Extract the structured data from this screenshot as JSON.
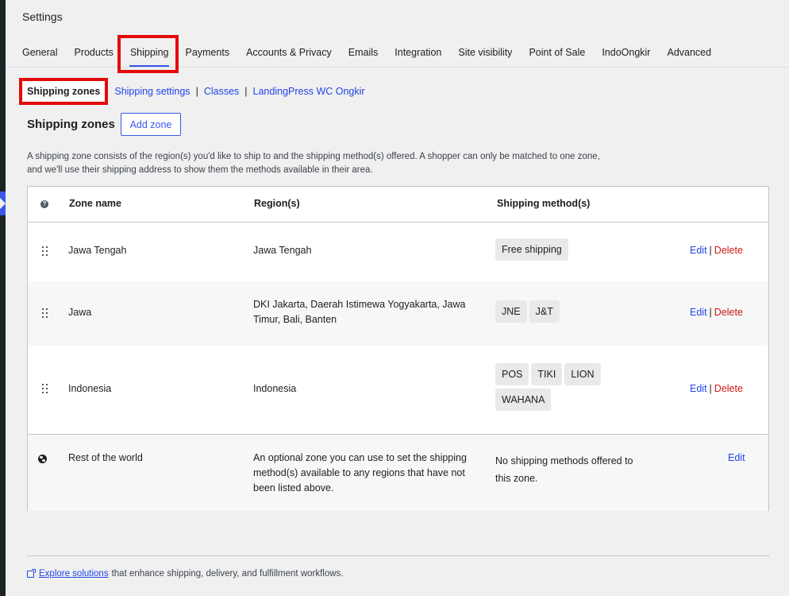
{
  "page": {
    "title": "Settings"
  },
  "tabs": [
    {
      "label": "General"
    },
    {
      "label": "Products"
    },
    {
      "label": "Shipping"
    },
    {
      "label": "Payments"
    },
    {
      "label": "Accounts & Privacy"
    },
    {
      "label": "Emails"
    },
    {
      "label": "Integration"
    },
    {
      "label": "Site visibility"
    },
    {
      "label": "Point of Sale"
    },
    {
      "label": "IndoOngkir"
    },
    {
      "label": "Advanced"
    }
  ],
  "active_tab": "Shipping",
  "subnav": {
    "current": "Shipping zones",
    "links": [
      "Shipping settings",
      "Classes",
      "LandingPress WC Ongkir"
    ],
    "separator": "|"
  },
  "zones": {
    "heading": "Shipping zones",
    "add_button": "Add zone",
    "description": "A shipping zone consists of the region(s) you'd like to ship to and the shipping method(s) offered. A shopper can only be matched to one zone, and we'll use their shipping address to show them the methods available in their area."
  },
  "table": {
    "help_icon": "question-icon",
    "headers": {
      "zone_name": "Zone name",
      "regions": "Region(s)",
      "methods": "Shipping method(s)"
    },
    "rows": [
      {
        "zone": "Jawa Tengah",
        "regions": "Jawa Tengah",
        "methods": [
          "Free shipping"
        ],
        "edit": "Edit",
        "separator": "|",
        "delete": "Delete"
      },
      {
        "zone": "Jawa",
        "regions": "DKI Jakarta, Daerah Istimewa Yogyakarta, Jawa Timur, Bali, Banten",
        "methods": [
          "JNE",
          "J&T"
        ],
        "edit": "Edit",
        "separator": "|",
        "delete": "Delete"
      },
      {
        "zone": "Indonesia",
        "regions": "Indonesia",
        "methods": [
          "POS",
          "TIKI",
          "LION",
          "WAHANA"
        ],
        "edit": "Edit",
        "separator": "|",
        "delete": "Delete"
      }
    ],
    "rest": {
      "icon": "globe-icon",
      "zone": "Rest of the world",
      "regions": "An optional zone you can use to set the shipping method(s) available to any regions that have not been listed above.",
      "methods": "No shipping methods offered to this zone.",
      "edit": "Edit"
    }
  },
  "footer": {
    "icon": "external-link-icon",
    "link": "Explore solutions",
    "text": "that enhance shipping, delivery, and fulfillment workflows."
  },
  "colors": {
    "accent": "#3858e9",
    "link": "#2145e6",
    "delete": "#cc1818",
    "highlight": "#e30a0a"
  }
}
